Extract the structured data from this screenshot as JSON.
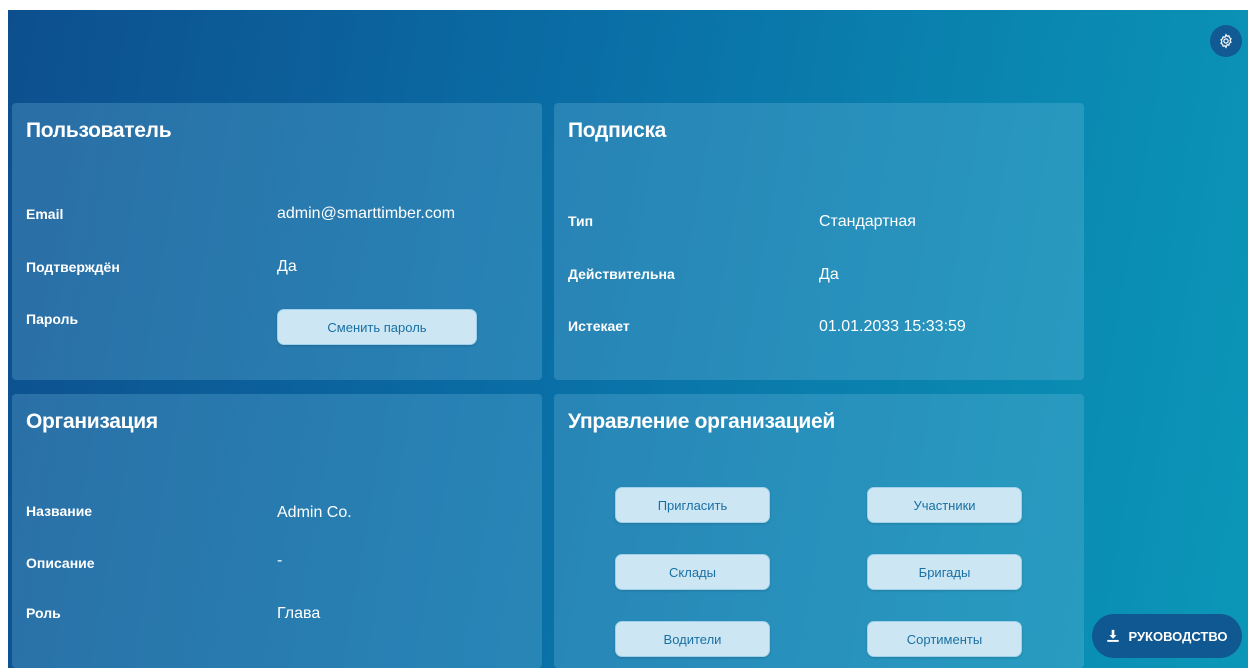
{
  "user": {
    "title": "Пользователь",
    "email_label": "Email",
    "email_value": "admin@smarttimber.com",
    "confirmed_label": "Подтверждён",
    "confirmed_value": "Да",
    "password_label": "Пароль",
    "change_password_button": "Сменить пароль"
  },
  "subscription": {
    "title": "Подписка",
    "type_label": "Тип",
    "type_value": "Стандартная",
    "valid_label": "Действительна",
    "valid_value": "Да",
    "expires_label": "Истекает",
    "expires_value": "01.01.2033 15:33:59"
  },
  "organization": {
    "title": "Организация",
    "name_label": "Название",
    "name_value": "Admin Co.",
    "description_label": "Описание",
    "description_value": "-",
    "role_label": "Роль",
    "role_value": "Глава"
  },
  "management": {
    "title": "Управление организацией",
    "invite_button": "Пригласить",
    "members_button": "Участники",
    "warehouses_button": "Склады",
    "brigades_button": "Бригады",
    "drivers_button": "Водители",
    "assortments_button": "Сортименты"
  },
  "guide_button": {
    "label": "РУКОВОДСТВО",
    "icon": "download-icon"
  },
  "settings_button": {
    "icon": "gear-icon"
  },
  "colors": {
    "gradient_start": "#0d4f8e",
    "gradient_end": "#0b97b8",
    "button_bg": "#cce7f3",
    "button_text": "#1a6fa3",
    "dark_button": "#0f5892"
  }
}
